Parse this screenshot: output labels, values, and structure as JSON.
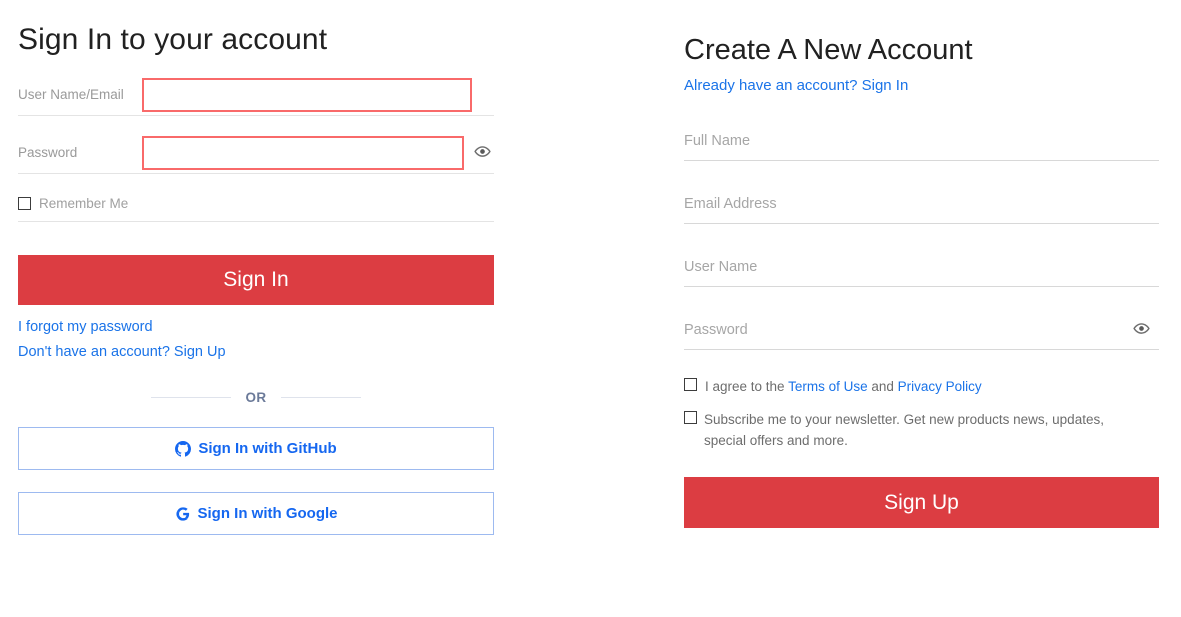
{
  "signin": {
    "title": "Sign In to your account",
    "fields": [
      {
        "label": "User Name/Email",
        "value": "",
        "placeholder": "",
        "name": "username-email"
      },
      {
        "label": "Password",
        "value": "",
        "placeholder": "",
        "name": "password"
      }
    ],
    "remember": {
      "label": "Remember Me",
      "checked": false
    },
    "submit_label": "Sign In",
    "forgot_link": "I forgot my password",
    "signup_link": "Don't have an account? Sign Up",
    "divider_text": "OR",
    "social": [
      {
        "label": "Sign In with GitHub",
        "icon": "github-icon"
      },
      {
        "label": "Sign In with Google",
        "icon": "google-icon"
      }
    ],
    "eye_icon": "eye-icon"
  },
  "signup": {
    "title": "Create A New Account",
    "subtitle_link": "Already have an account? Sign In",
    "fields": [
      {
        "placeholder": "Full Name",
        "value": "",
        "name": "full-name"
      },
      {
        "placeholder": "Email Address",
        "value": "",
        "name": "email-address"
      },
      {
        "placeholder": "User Name",
        "value": "",
        "name": "user-name"
      },
      {
        "placeholder": "Password",
        "value": "",
        "name": "password"
      }
    ],
    "terms": {
      "prefix": "I agree to the ",
      "terms_link": "Terms of Use",
      "middle": " and ",
      "privacy_link": "Privacy Policy",
      "checked": false
    },
    "newsletter": {
      "text": "Subscribe me to your newsletter. Get new products news, updates, special offers and more.",
      "checked": false
    },
    "submit_label": "Sign Up",
    "eye_icon": "eye-icon"
  },
  "colors": {
    "primary_red": "#dc3d42",
    "link_blue": "#1a73e8",
    "social_blue": "#1567f0",
    "input_error_border": "#f96a6a",
    "label_gray": "#9a9a9a"
  }
}
